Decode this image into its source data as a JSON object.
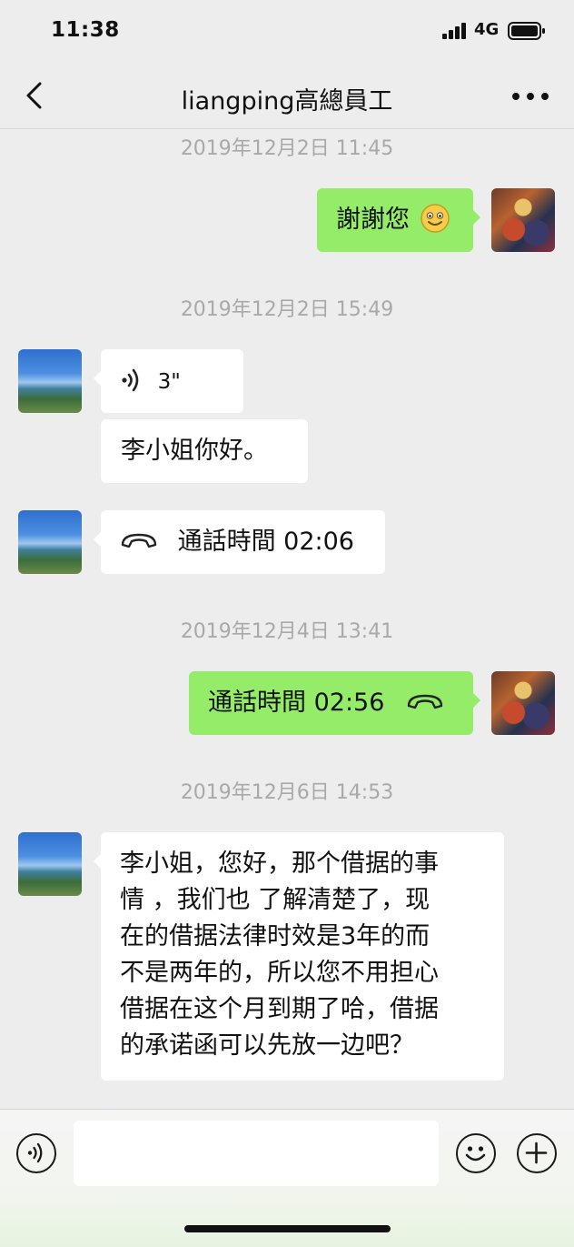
{
  "status_bar": {
    "time": "11:38",
    "network": "4G"
  },
  "header": {
    "title": "liangping高總員工"
  },
  "messages": {
    "ts1": "2019年12月2日 11:45",
    "m1_text": "謝謝您",
    "ts2": "2019年12月2日 15:49",
    "voice_duration": "3\"",
    "m3_text": "李小姐你好。",
    "call_in_text": "通話時間 02:06",
    "ts3": "2019年12月4日 13:41",
    "call_out_text": "通話時間 02:56",
    "ts4": "2019年12月6日 14:53",
    "long_lines": [
      "李小姐，您好，那个借据的事",
      "情 ，我们也 了解清楚了，现",
      "在的借据法律时效是3年的而",
      "不是两年的，所以您不用担心",
      "借据在这个月到期了哈，借据",
      "的承诺函可以先放一边吧？"
    ]
  },
  "colors": {
    "background": "#ededed",
    "incoming_bubble": "#ffffff",
    "outgoing_bubble": "#95ec69",
    "timestamp": "#a9a9a9"
  },
  "icons": [
    "back-chevron-icon",
    "more-dots-icon",
    "voice-wave-icon",
    "phone-handset-icon",
    "emoji-smile-icon",
    "voice-input-icon",
    "plus-icon"
  ]
}
